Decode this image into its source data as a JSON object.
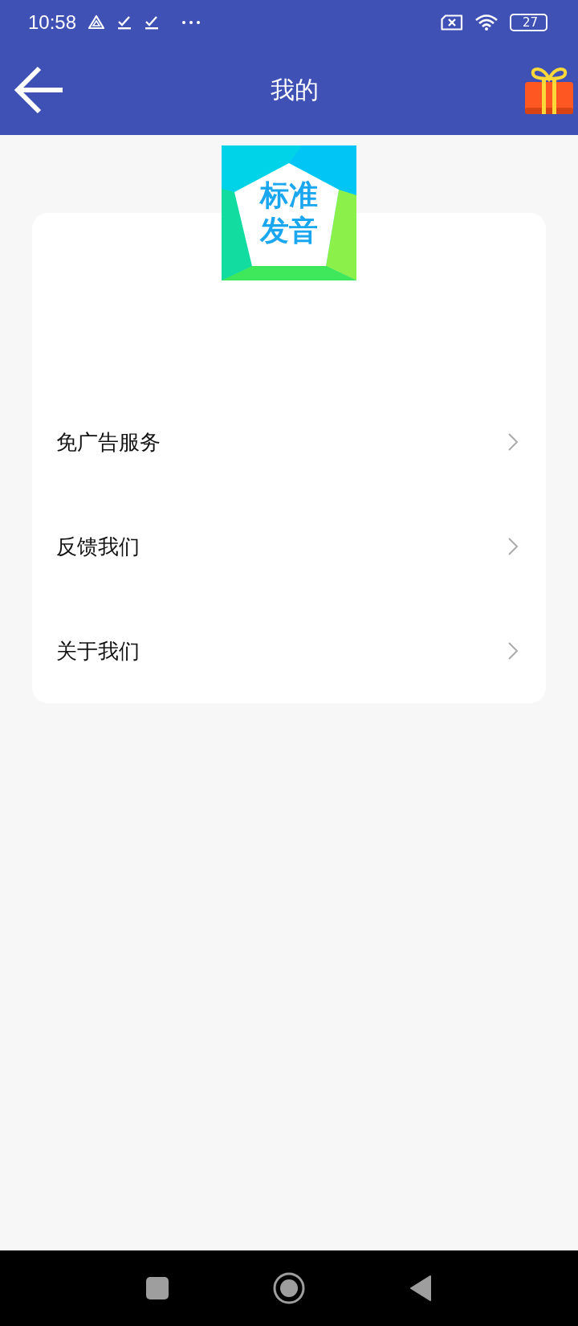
{
  "status_bar": {
    "time": "10:58",
    "battery": "27"
  },
  "app_bar": {
    "title": "我的"
  },
  "logo": {
    "lines": [
      "标准",
      "发音"
    ]
  },
  "menu": [
    {
      "label": "免广告服务"
    },
    {
      "label": "反馈我们"
    },
    {
      "label": "关于我们"
    }
  ]
}
